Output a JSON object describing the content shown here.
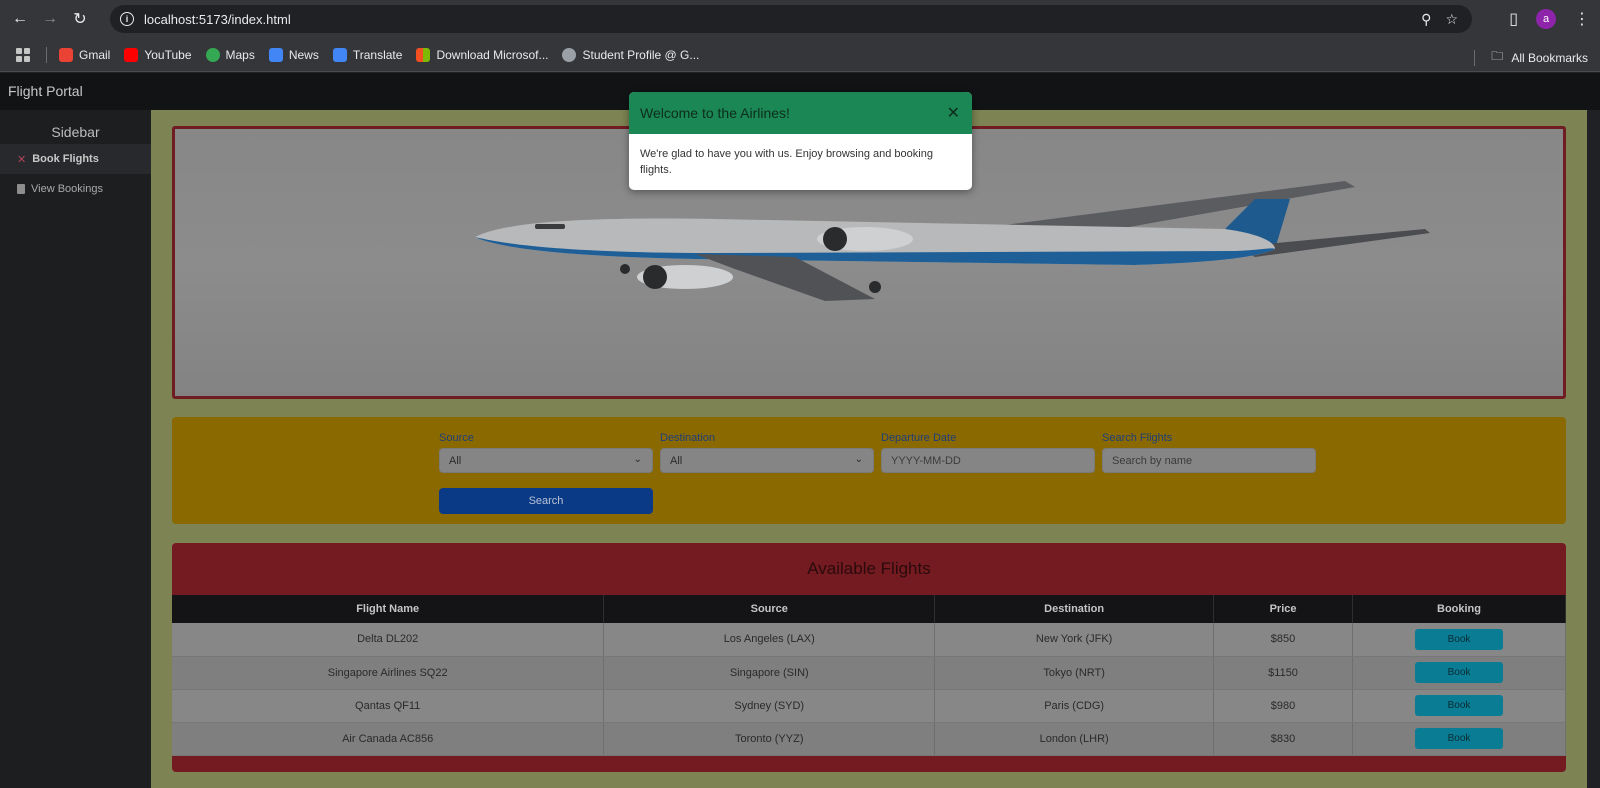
{
  "browser": {
    "url": "localhost:5173/index.html",
    "profile_initial": "a",
    "bookmarks": [
      {
        "label": "Gmail",
        "icon": "gmail-icon",
        "color": "#ea4335"
      },
      {
        "label": "YouTube",
        "icon": "youtube-icon",
        "color": "#ff0000"
      },
      {
        "label": "Maps",
        "icon": "maps-icon",
        "color": "#34a853"
      },
      {
        "label": "News",
        "icon": "news-icon",
        "color": "#4285f4"
      },
      {
        "label": "Translate",
        "icon": "translate-icon",
        "color": "#4285f4"
      },
      {
        "label": "Download Microsof...",
        "icon": "microsoft-icon",
        "color": "#f25022"
      },
      {
        "label": "Student Profile @ G...",
        "icon": "globe-icon",
        "color": "#9aa0a6"
      }
    ],
    "all_bookmarks": "All Bookmarks"
  },
  "app": {
    "brand": "Flight Portal"
  },
  "sidebar": {
    "title": "Sidebar",
    "items": [
      {
        "label": "Book Flights",
        "active": true
      },
      {
        "label": "View Bookings",
        "active": false
      }
    ]
  },
  "filters": {
    "source_label": "Source",
    "source_value": "All",
    "destination_label": "Destination",
    "destination_value": "All",
    "date_label": "Departure Date",
    "date_placeholder": "YYYY-MM-DD",
    "search_label": "Search Flights",
    "search_placeholder": "Search by name",
    "search_button": "Search"
  },
  "flights": {
    "title": "Available Flights",
    "columns": [
      "Flight Name",
      "Source",
      "Destination",
      "Price",
      "Booking"
    ],
    "rows": [
      {
        "name": "Delta DL202",
        "source": "Los Angeles (LAX)",
        "destination": "New York (JFK)",
        "price": "$850",
        "action": "Book"
      },
      {
        "name": "Singapore Airlines SQ22",
        "source": "Singapore (SIN)",
        "destination": "Tokyo (NRT)",
        "price": "$1150",
        "action": "Book"
      },
      {
        "name": "Qantas QF11",
        "source": "Sydney (SYD)",
        "destination": "Paris (CDG)",
        "price": "$980",
        "action": "Book"
      },
      {
        "name": "Air Canada AC856",
        "source": "Toronto (YYZ)",
        "destination": "London (LHR)",
        "price": "$830",
        "action": "Book"
      }
    ]
  },
  "toast": {
    "title": "Welcome to the Airlines!",
    "body": "We're glad to have you with us. Enjoy browsing and booking flights."
  },
  "colors": {
    "toast_header": "#198754",
    "filter_bar": "#ffc107",
    "flights_header": "#dc3545",
    "search_button": "#0d6efd",
    "book_button": "#0dcaf0"
  }
}
